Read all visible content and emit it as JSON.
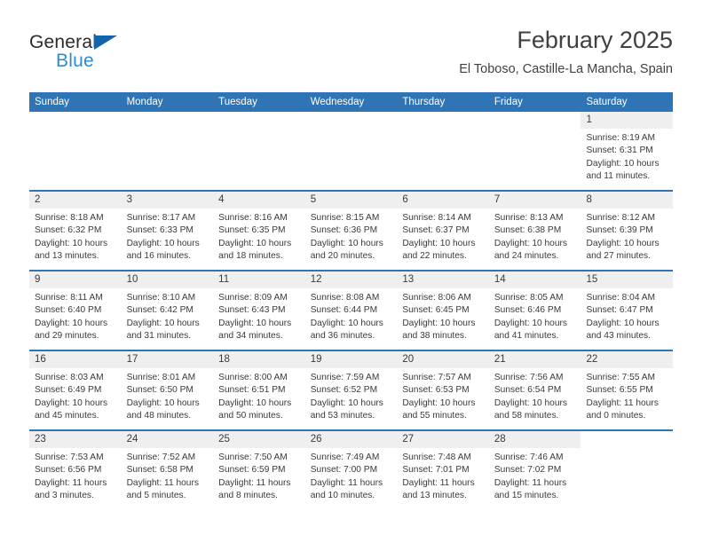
{
  "brand": {
    "name_top": "General",
    "name_bottom": "Blue",
    "accent_color": "#2b8bd6",
    "triangle_color": "#1464aa"
  },
  "header": {
    "title": "February 2025",
    "subtitle": "El Toboso, Castille-La Mancha, Spain"
  },
  "calendar": {
    "header_color": "#2f75b5",
    "daynum_band_color": "#efefef",
    "weekday_headers": [
      "Sunday",
      "Monday",
      "Tuesday",
      "Wednesday",
      "Thursday",
      "Friday",
      "Saturday"
    ],
    "weeks": [
      [
        {
          "day": "",
          "empty": true
        },
        {
          "day": "",
          "empty": true
        },
        {
          "day": "",
          "empty": true
        },
        {
          "day": "",
          "empty": true
        },
        {
          "day": "",
          "empty": true
        },
        {
          "day": "",
          "empty": true
        },
        {
          "day": "1",
          "sunrise": "Sunrise: 8:19 AM",
          "sunset": "Sunset: 6:31 PM",
          "daylight": "Daylight: 10 hours and 11 minutes."
        }
      ],
      [
        {
          "day": "2",
          "sunrise": "Sunrise: 8:18 AM",
          "sunset": "Sunset: 6:32 PM",
          "daylight": "Daylight: 10 hours and 13 minutes."
        },
        {
          "day": "3",
          "sunrise": "Sunrise: 8:17 AM",
          "sunset": "Sunset: 6:33 PM",
          "daylight": "Daylight: 10 hours and 16 minutes."
        },
        {
          "day": "4",
          "sunrise": "Sunrise: 8:16 AM",
          "sunset": "Sunset: 6:35 PM",
          "daylight": "Daylight: 10 hours and 18 minutes."
        },
        {
          "day": "5",
          "sunrise": "Sunrise: 8:15 AM",
          "sunset": "Sunset: 6:36 PM",
          "daylight": "Daylight: 10 hours and 20 minutes."
        },
        {
          "day": "6",
          "sunrise": "Sunrise: 8:14 AM",
          "sunset": "Sunset: 6:37 PM",
          "daylight": "Daylight: 10 hours and 22 minutes."
        },
        {
          "day": "7",
          "sunrise": "Sunrise: 8:13 AM",
          "sunset": "Sunset: 6:38 PM",
          "daylight": "Daylight: 10 hours and 24 minutes."
        },
        {
          "day": "8",
          "sunrise": "Sunrise: 8:12 AM",
          "sunset": "Sunset: 6:39 PM",
          "daylight": "Daylight: 10 hours and 27 minutes."
        }
      ],
      [
        {
          "day": "9",
          "sunrise": "Sunrise: 8:11 AM",
          "sunset": "Sunset: 6:40 PM",
          "daylight": "Daylight: 10 hours and 29 minutes."
        },
        {
          "day": "10",
          "sunrise": "Sunrise: 8:10 AM",
          "sunset": "Sunset: 6:42 PM",
          "daylight": "Daylight: 10 hours and 31 minutes."
        },
        {
          "day": "11",
          "sunrise": "Sunrise: 8:09 AM",
          "sunset": "Sunset: 6:43 PM",
          "daylight": "Daylight: 10 hours and 34 minutes."
        },
        {
          "day": "12",
          "sunrise": "Sunrise: 8:08 AM",
          "sunset": "Sunset: 6:44 PM",
          "daylight": "Daylight: 10 hours and 36 minutes."
        },
        {
          "day": "13",
          "sunrise": "Sunrise: 8:06 AM",
          "sunset": "Sunset: 6:45 PM",
          "daylight": "Daylight: 10 hours and 38 minutes."
        },
        {
          "day": "14",
          "sunrise": "Sunrise: 8:05 AM",
          "sunset": "Sunset: 6:46 PM",
          "daylight": "Daylight: 10 hours and 41 minutes."
        },
        {
          "day": "15",
          "sunrise": "Sunrise: 8:04 AM",
          "sunset": "Sunset: 6:47 PM",
          "daylight": "Daylight: 10 hours and 43 minutes."
        }
      ],
      [
        {
          "day": "16",
          "sunrise": "Sunrise: 8:03 AM",
          "sunset": "Sunset: 6:49 PM",
          "daylight": "Daylight: 10 hours and 45 minutes."
        },
        {
          "day": "17",
          "sunrise": "Sunrise: 8:01 AM",
          "sunset": "Sunset: 6:50 PM",
          "daylight": "Daylight: 10 hours and 48 minutes."
        },
        {
          "day": "18",
          "sunrise": "Sunrise: 8:00 AM",
          "sunset": "Sunset: 6:51 PM",
          "daylight": "Daylight: 10 hours and 50 minutes."
        },
        {
          "day": "19",
          "sunrise": "Sunrise: 7:59 AM",
          "sunset": "Sunset: 6:52 PM",
          "daylight": "Daylight: 10 hours and 53 minutes."
        },
        {
          "day": "20",
          "sunrise": "Sunrise: 7:57 AM",
          "sunset": "Sunset: 6:53 PM",
          "daylight": "Daylight: 10 hours and 55 minutes."
        },
        {
          "day": "21",
          "sunrise": "Sunrise: 7:56 AM",
          "sunset": "Sunset: 6:54 PM",
          "daylight": "Daylight: 10 hours and 58 minutes."
        },
        {
          "day": "22",
          "sunrise": "Sunrise: 7:55 AM",
          "sunset": "Sunset: 6:55 PM",
          "daylight": "Daylight: 11 hours and 0 minutes."
        }
      ],
      [
        {
          "day": "23",
          "sunrise": "Sunrise: 7:53 AM",
          "sunset": "Sunset: 6:56 PM",
          "daylight": "Daylight: 11 hours and 3 minutes."
        },
        {
          "day": "24",
          "sunrise": "Sunrise: 7:52 AM",
          "sunset": "Sunset: 6:58 PM",
          "daylight": "Daylight: 11 hours and 5 minutes."
        },
        {
          "day": "25",
          "sunrise": "Sunrise: 7:50 AM",
          "sunset": "Sunset: 6:59 PM",
          "daylight": "Daylight: 11 hours and 8 minutes."
        },
        {
          "day": "26",
          "sunrise": "Sunrise: 7:49 AM",
          "sunset": "Sunset: 7:00 PM",
          "daylight": "Daylight: 11 hours and 10 minutes."
        },
        {
          "day": "27",
          "sunrise": "Sunrise: 7:48 AM",
          "sunset": "Sunset: 7:01 PM",
          "daylight": "Daylight: 11 hours and 13 minutes."
        },
        {
          "day": "28",
          "sunrise": "Sunrise: 7:46 AM",
          "sunset": "Sunset: 7:02 PM",
          "daylight": "Daylight: 11 hours and 15 minutes."
        },
        {
          "day": "",
          "empty": true
        }
      ]
    ]
  }
}
